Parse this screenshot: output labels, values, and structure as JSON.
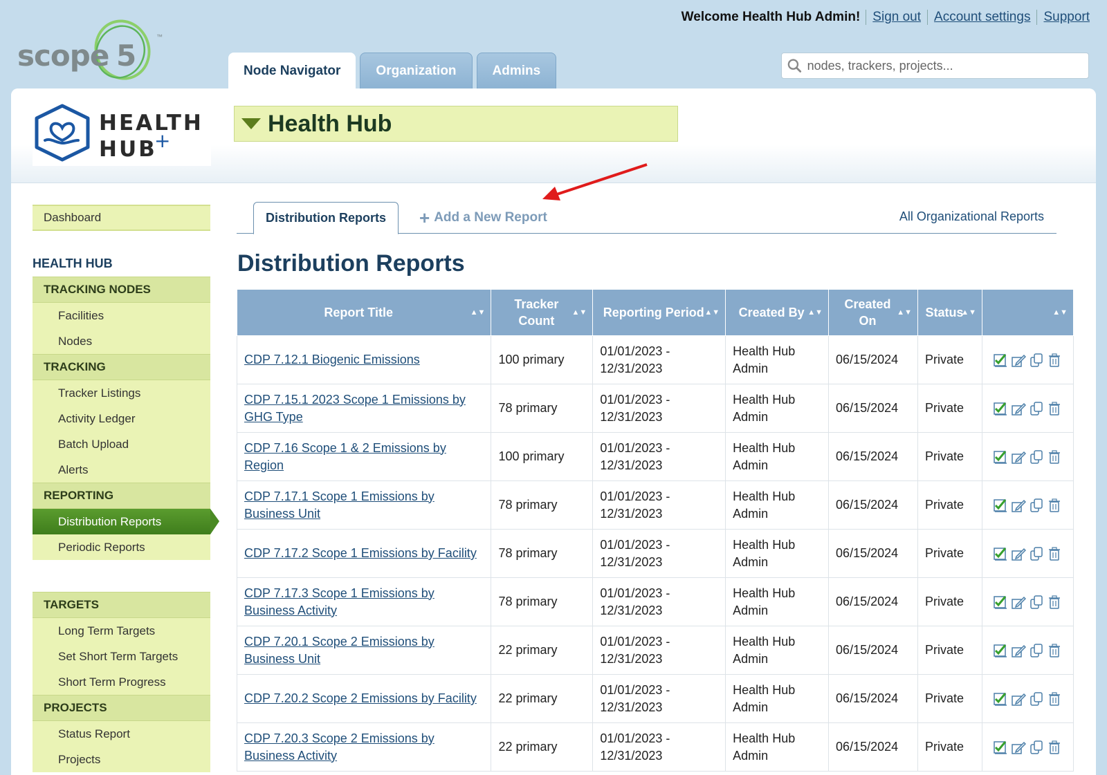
{
  "brand": {
    "logo_text": "scope",
    "logo_number": "5",
    "tm": "™"
  },
  "topbar": {
    "welcome": "Welcome Health Hub Admin!",
    "sign_out": "Sign out",
    "account_settings": "Account settings",
    "support": "Support"
  },
  "main_tabs": [
    {
      "label": "Node Navigator",
      "active": true
    },
    {
      "label": "Organization",
      "active": false
    },
    {
      "label": "Admins",
      "active": false
    }
  ],
  "search": {
    "placeholder": "nodes, trackers, projects..."
  },
  "org": {
    "logo_line1": "HEALTH",
    "logo_line2": "HUB",
    "logo_plus": "+",
    "title": "Health Hub"
  },
  "sidebar": {
    "dashboard": "Dashboard",
    "section_title": "HEALTH HUB",
    "groups": [
      {
        "category": "TRACKING NODES",
        "items": [
          "Facilities",
          "Nodes"
        ]
      },
      {
        "category": "TRACKING",
        "items": [
          "Tracker Listings",
          "Activity Ledger",
          "Batch Upload",
          "Alerts"
        ]
      },
      {
        "category": "REPORTING",
        "items": [
          "Distribution Reports",
          "Periodic Reports"
        ]
      },
      {
        "category": "TARGETS",
        "items": [
          "Long Term Targets",
          "Set Short Term Targets",
          "Short Term Progress"
        ]
      },
      {
        "category": "PROJECTS",
        "items": [
          "Status Report",
          "Projects"
        ]
      }
    ]
  },
  "subtabs": {
    "active": "Distribution Reports",
    "add": "Add a New Report",
    "all": "All Organizational Reports"
  },
  "page_title": "Distribution Reports",
  "table": {
    "headers": [
      "Report Title",
      "Tracker Count",
      "Reporting Period",
      "Created By",
      "Created On",
      "Status",
      ""
    ],
    "rows": [
      {
        "title": "CDP 7.12.1 Biogenic Emissions",
        "count": "100 primary",
        "period": "01/01/2023 - 12/31/2023",
        "created_by": "Health Hub Admin",
        "created_on": "06/15/2024",
        "status": "Private"
      },
      {
        "title": "CDP 7.15.1 2023 Scope 1 Emissions by GHG Type",
        "count": "78 primary",
        "period": "01/01/2023 - 12/31/2023",
        "created_by": "Health Hub Admin",
        "created_on": "06/15/2024",
        "status": "Private"
      },
      {
        "title": "CDP 7.16 Scope 1 & 2 Emissions by Region",
        "count": "100 primary",
        "period": "01/01/2023 - 12/31/2023",
        "created_by": "Health Hub Admin",
        "created_on": "06/15/2024",
        "status": "Private"
      },
      {
        "title": "CDP 7.17.1 Scope 1 Emissions by Business Unit",
        "count": "78 primary",
        "period": "01/01/2023 - 12/31/2023",
        "created_by": "Health Hub Admin",
        "created_on": "06/15/2024",
        "status": "Private"
      },
      {
        "title": "CDP 7.17.2 Scope 1 Emissions by Facility",
        "count": "78 primary",
        "period": "01/01/2023 - 12/31/2023",
        "created_by": "Health Hub Admin",
        "created_on": "06/15/2024",
        "status": "Private"
      },
      {
        "title": "CDP 7.17.3 Scope 1 Emissions by Business Activity",
        "count": "78 primary",
        "period": "01/01/2023 - 12/31/2023",
        "created_by": "Health Hub Admin",
        "created_on": "06/15/2024",
        "status": "Private"
      },
      {
        "title": "CDP 7.20.1 Scope 2 Emissions by Business Unit",
        "count": "22 primary",
        "period": "01/01/2023 - 12/31/2023",
        "created_by": "Health Hub Admin",
        "created_on": "06/15/2024",
        "status": "Private"
      },
      {
        "title": "CDP 7.20.2 Scope 2 Emissions by Facility",
        "count": "22 primary",
        "period": "01/01/2023 - 12/31/2023",
        "created_by": "Health Hub Admin",
        "created_on": "06/15/2024",
        "status": "Private"
      },
      {
        "title": "CDP 7.20.3 Scope 2 Emissions by Business Activity",
        "count": "22 primary",
        "period": "01/01/2023 - 12/31/2023",
        "created_by": "Health Hub Admin",
        "created_on": "06/15/2024",
        "status": "Private"
      }
    ]
  },
  "icons": {
    "search": "search-icon",
    "toggle": "triangle-down-icon",
    "add": "plus-icon",
    "sort": "sort-icon",
    "approve": "checkmark-icon",
    "edit": "edit-icon",
    "copy": "copy-icon",
    "delete": "trash-icon",
    "annotation": "red-arrow-icon"
  },
  "colors": {
    "accent_green": "#4a8a24",
    "header_blue": "#87aacb",
    "link_blue": "#1f4e79",
    "sidebar_bg": "#eaf3b5",
    "annotation_red": "#e01b1b"
  }
}
